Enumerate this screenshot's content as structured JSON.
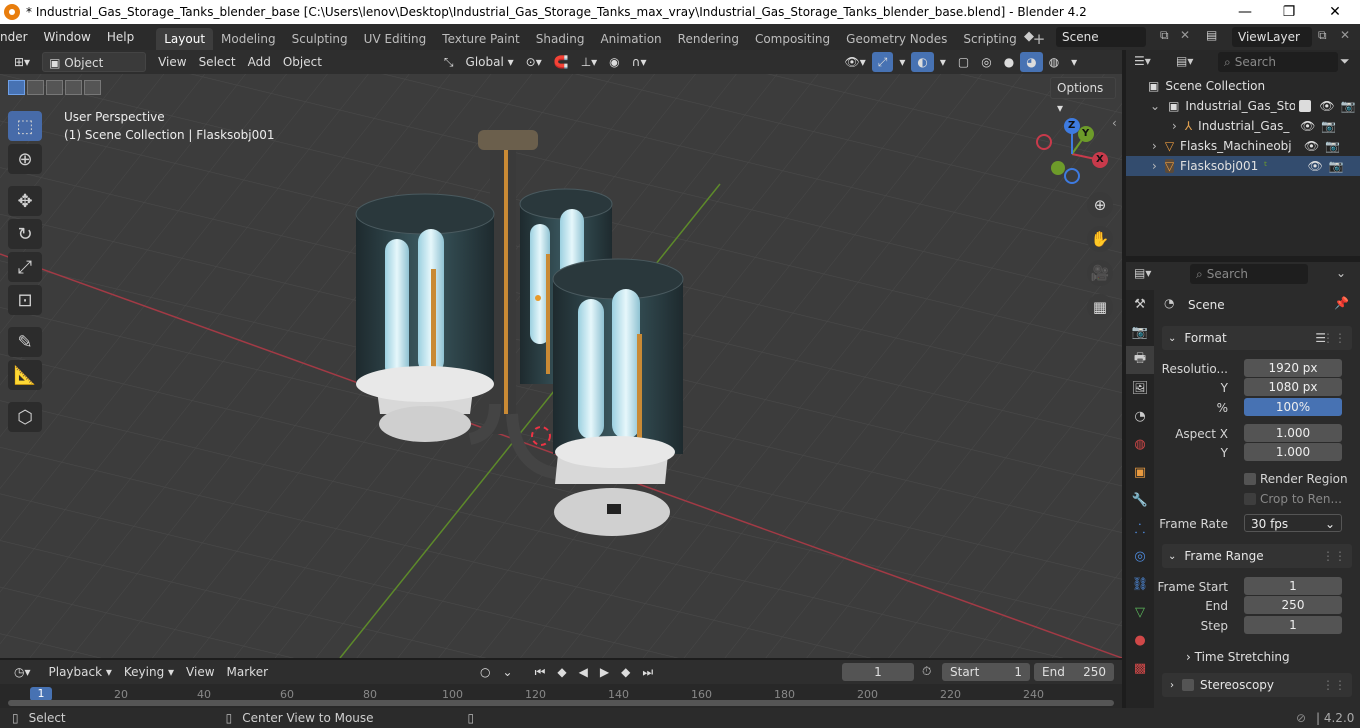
{
  "titlebar": {
    "title": "* Industrial_Gas_Storage_Tanks_blender_base [C:\\Users\\lenov\\Desktop\\Industrial_Gas_Storage_Tanks_max_vray\\Industrial_Gas_Storage_Tanks_blender_base.blend] - Blender 4.2",
    "min": "—",
    "max": "❐",
    "close": "✕"
  },
  "menu": {
    "render": "nder",
    "window": "Window",
    "help": "Help"
  },
  "workspaces": [
    "Layout",
    "Modeling",
    "Sculpting",
    "UV Editing",
    "Texture Paint",
    "Shading",
    "Animation",
    "Rendering",
    "Compositing",
    "Geometry Nodes",
    "Scripting"
  ],
  "workspace_add": "+",
  "scene_field": "Scene",
  "viewlayer_field": "ViewLayer",
  "viewport_header": {
    "mode": "Object Mode",
    "view": "View",
    "select": "Select",
    "add": "Add",
    "object": "Object",
    "orientation": "Global",
    "options": "Options"
  },
  "viewport": {
    "perspective": "User Perspective",
    "collection_info": "(1) Scene Collection | Flasksobj001",
    "axis_x": "X",
    "axis_y": "Y",
    "axis_z": "Z"
  },
  "outliner": {
    "search_placeholder": "Search",
    "rows": [
      {
        "label": "Scene Collection"
      },
      {
        "label": "Industrial_Gas_Sto"
      },
      {
        "label": "Industrial_Gas_"
      },
      {
        "label": "Flasks_Machineobj"
      },
      {
        "label": "Flasksobj001"
      }
    ]
  },
  "properties": {
    "search_placeholder": "Search",
    "context": "Scene",
    "format": {
      "title": "Format",
      "resolution_label": "Resolutio...",
      "resolution_x": "1920 px",
      "y_label": "Y",
      "resolution_y": "1080 px",
      "pct_label": "%",
      "pct": "100%",
      "aspect_label": "Aspect X",
      "aspect_x": "1.000",
      "aspect_y_label": "Y",
      "aspect_y": "1.000",
      "render_region": "Render Region",
      "crop": "Crop to Ren...",
      "frame_rate_label": "Frame Rate",
      "frame_rate": "30 fps"
    },
    "frame_range": {
      "title": "Frame Range",
      "start_label": "Frame Start",
      "start": "1",
      "end_label": "End",
      "end": "250",
      "step_label": "Step",
      "step": "1"
    },
    "time_stretching": "Time Stretching",
    "stereoscopy": "Stereoscopy"
  },
  "timeline": {
    "playback": "Playback",
    "keying": "Keying",
    "view": "View",
    "marker": "Marker",
    "current_frame": "1",
    "start_label": "Start",
    "start": "1",
    "end_label": "End",
    "end": "250",
    "ruler": [
      "1",
      "20",
      "40",
      "60",
      "80",
      "100",
      "120",
      "140",
      "160",
      "180",
      "200",
      "220",
      "240"
    ]
  },
  "statusbar": {
    "select": "Select",
    "center": "Center View to Mouse",
    "version": "4.2.0"
  },
  "colors": {
    "accent": "#4772b3",
    "x_axis": "#c83a4b",
    "y_axis": "#6d9b2a",
    "z_axis": "#3e7be0"
  }
}
